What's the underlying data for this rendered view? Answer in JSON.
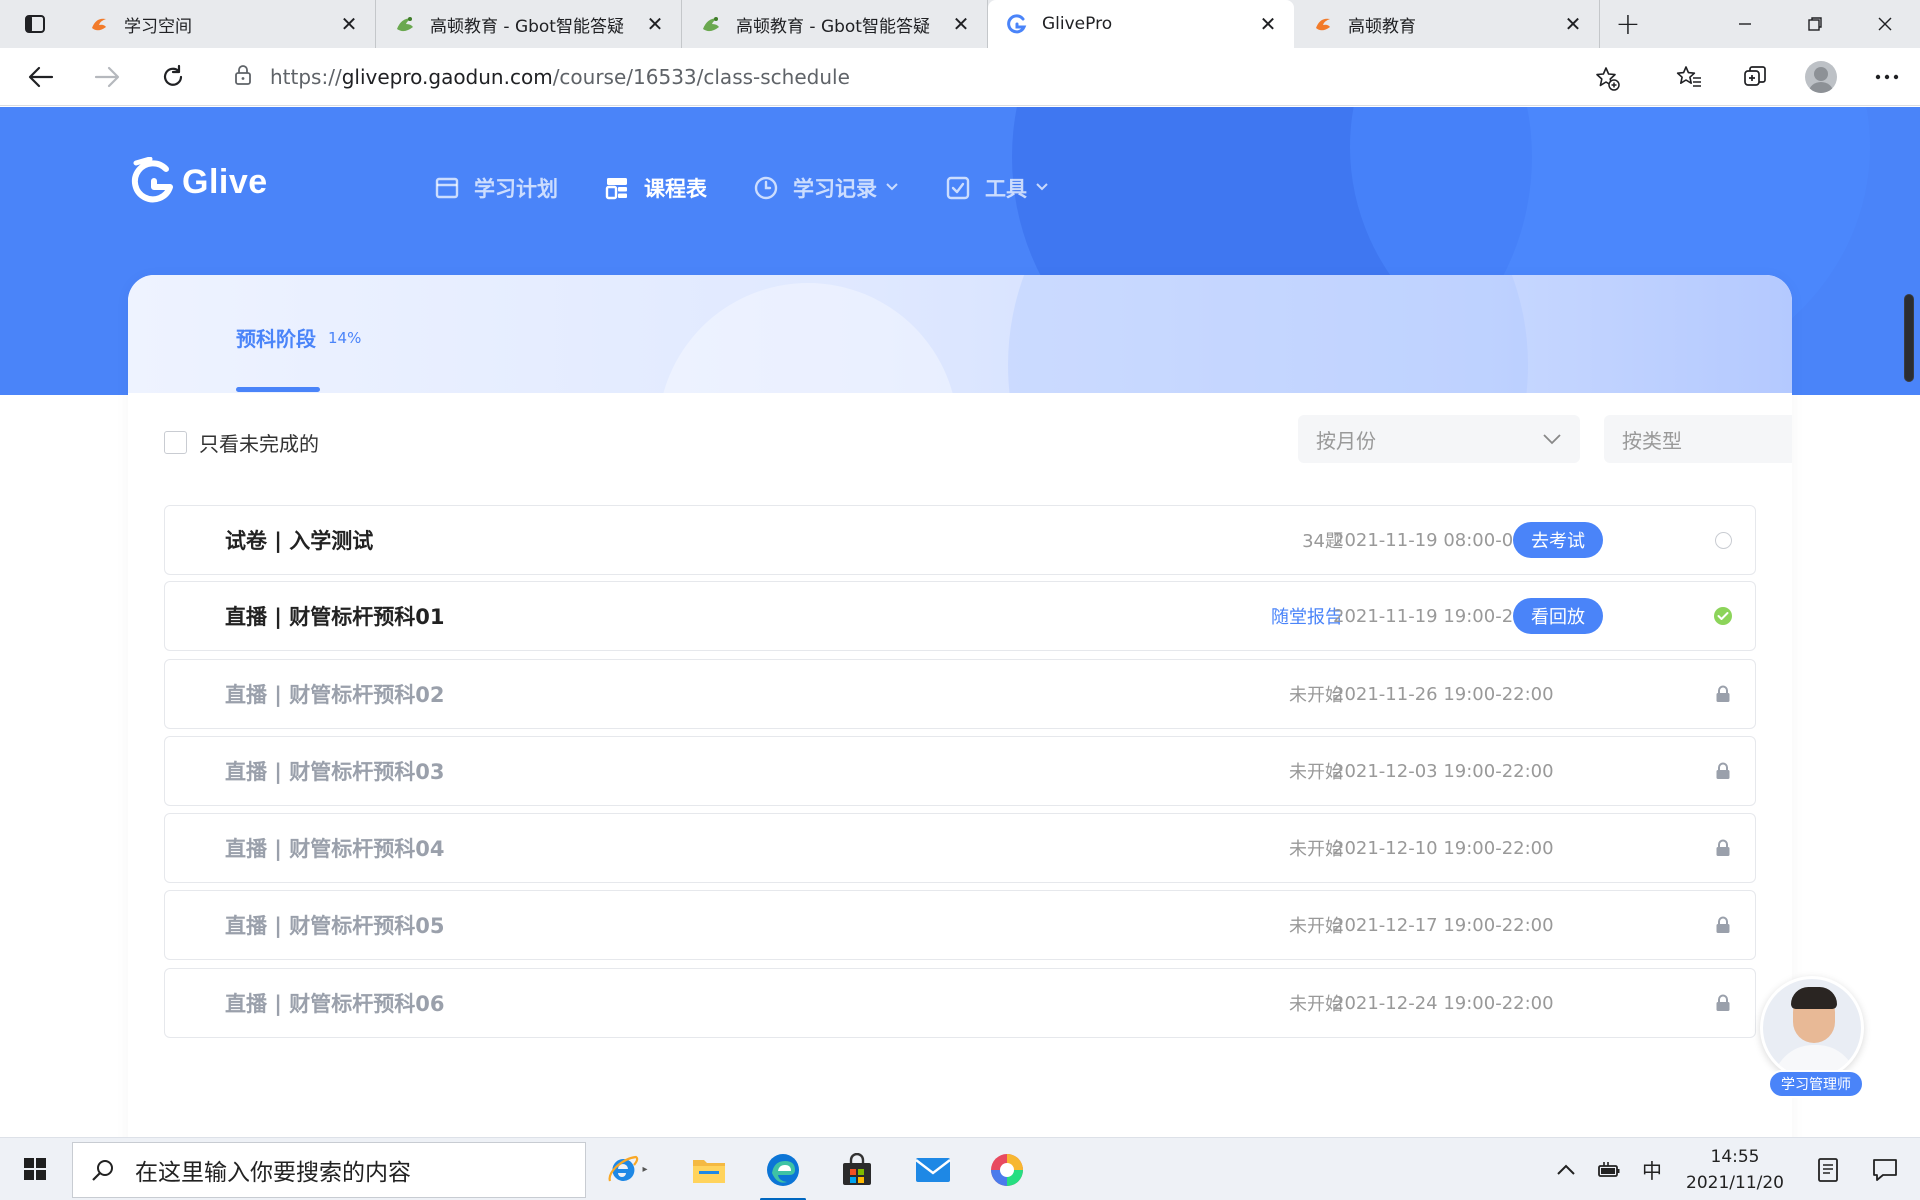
{
  "browser": {
    "tabs": [
      {
        "title": "学习空间",
        "favicon": "gaodun-orange-icon",
        "active": false
      },
      {
        "title": "高顿教育 - Gbot智能答疑",
        "favicon": "gbot-green-icon",
        "active": false
      },
      {
        "title": "高顿教育 - Gbot智能答疑",
        "favicon": "gbot-green-icon",
        "active": false
      },
      {
        "title": "GlivePro",
        "favicon": "glive-blue-icon",
        "active": true
      },
      {
        "title": "高顿教育",
        "favicon": "gaodun-orange-icon",
        "active": false
      }
    ],
    "url_scheme": "https://",
    "url_host": "glivepro.gaodun.com",
    "url_path": "/course/16533/class-schedule"
  },
  "app": {
    "logo_text": "Glive",
    "nav": [
      {
        "label": "学习计划",
        "icon": "calendar-icon",
        "active": false,
        "dropdown": false
      },
      {
        "label": "课程表",
        "icon": "schedule-icon",
        "active": true,
        "dropdown": false
      },
      {
        "label": "学习记录",
        "icon": "clock-icon",
        "active": false,
        "dropdown": true
      },
      {
        "label": "工具",
        "icon": "checkbox-icon",
        "active": false,
        "dropdown": true
      }
    ],
    "accent_color": "#4a84f9"
  },
  "stage": {
    "name": "预科阶段",
    "progress": "14%"
  },
  "filters": {
    "only_incomplete_label": "只看未完成的",
    "only_incomplete_checked": false,
    "by_month_placeholder": "按月份",
    "by_type_placeholder": "按类型"
  },
  "schedule": [
    {
      "title": "试卷 | 入学测试",
      "meta": "34题",
      "meta_link": false,
      "time": "2021-11-19 08:00-08:15",
      "button": "去考试",
      "status": "pending",
      "locked": false
    },
    {
      "title": "直播 | 财管标杆预科01",
      "meta": "随堂报告",
      "meta_link": true,
      "time": "2021-11-19 19:00-22:00",
      "button": "看回放",
      "status": "done",
      "locked": false
    },
    {
      "title": "直播 | 财管标杆预科02",
      "meta": "未开始",
      "meta_link": false,
      "time": "2021-11-26 19:00-22:00",
      "button": "",
      "status": "locked",
      "locked": true
    },
    {
      "title": "直播 | 财管标杆预科03",
      "meta": "未开始",
      "meta_link": false,
      "time": "2021-12-03 19:00-22:00",
      "button": "",
      "status": "locked",
      "locked": true
    },
    {
      "title": "直播 | 财管标杆预科04",
      "meta": "未开始",
      "meta_link": false,
      "time": "2021-12-10 19:00-22:00",
      "button": "",
      "status": "locked",
      "locked": true
    },
    {
      "title": "直播 | 财管标杆预科05",
      "meta": "未开始",
      "meta_link": false,
      "time": "2021-12-17 19:00-22:00",
      "button": "",
      "status": "locked",
      "locked": true
    },
    {
      "title": "直播 | 财管标杆预科06",
      "meta": "未开始",
      "meta_link": false,
      "time": "2021-12-24 19:00-22:00",
      "button": "",
      "status": "locked",
      "locked": true
    }
  ],
  "helper": {
    "badge": "学习管理师"
  },
  "taskbar": {
    "search_placeholder": "在这里输入你要搜索的内容",
    "ime": "中",
    "time": "14:55",
    "date": "2021/11/20"
  }
}
